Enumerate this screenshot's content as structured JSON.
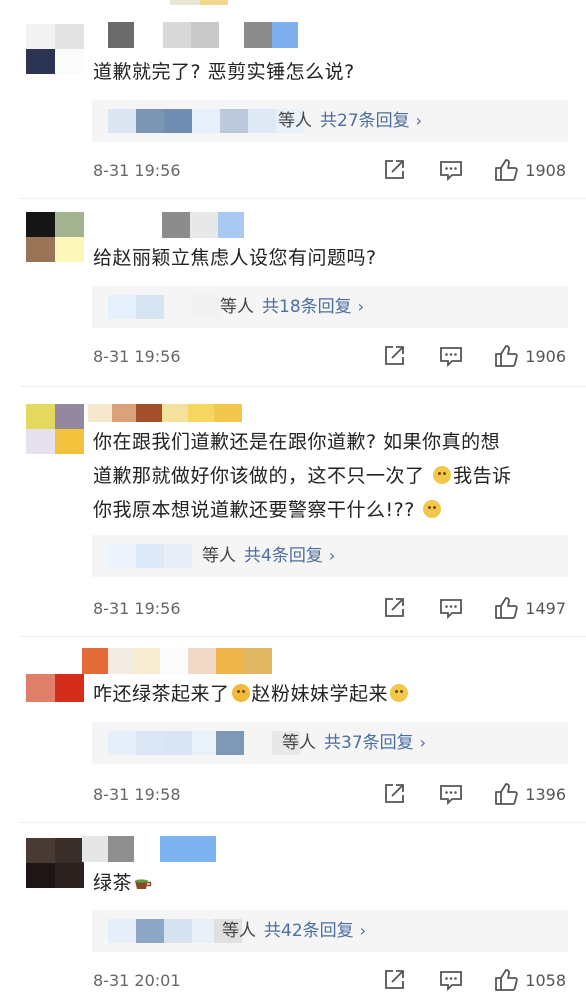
{
  "comments": [
    {
      "text": "道歉就完了? 恶剪实锤怎么说?",
      "reply_who": "等人",
      "reply_count": "共27条回复",
      "time": "8-31 19:56",
      "likes": "1908"
    },
    {
      "text": "给赵丽颖立焦虑人设您有问题吗?",
      "reply_who": "等人",
      "reply_count": "共18条回复",
      "time": "8-31 19:56",
      "likes": "1906"
    },
    {
      "text_line1": "你在跟我们道歉还是在跟你道歉? 如果你真的想",
      "text_line2": "道歉那就做好你该做的，这不只一次了",
      "text_line2b": "我告诉",
      "text_line3": "你我原本想说道歉还要警察干什么!??",
      "reply_who": "等人",
      "reply_count": "共4条回复",
      "time": "8-31 19:56",
      "likes": "1497"
    },
    {
      "text_a": "咋还绿茶起来了",
      "text_b": "赵粉妹妹学起来",
      "reply_who": "等人",
      "reply_count": "共37条回复",
      "time": "8-31 19:58",
      "likes": "1396"
    },
    {
      "text": "绿茶",
      "reply_who": "等人",
      "reply_count": "共42条回复",
      "time": "8-31 20:01",
      "likes": "1058"
    }
  ],
  "icons": {
    "share": "share-icon",
    "comment": "comment-icon",
    "like": "thumbs-up-icon",
    "chevron": "chevron-right-icon",
    "emoji_smile": "smile-emoji",
    "emoji_cry": "crying-emoji",
    "emoji_tea": "tea-cup-emoji"
  },
  "colors": {
    "link": "#4c6ea0",
    "reply_bg": "#f5f5f5",
    "meta": "#666666"
  }
}
